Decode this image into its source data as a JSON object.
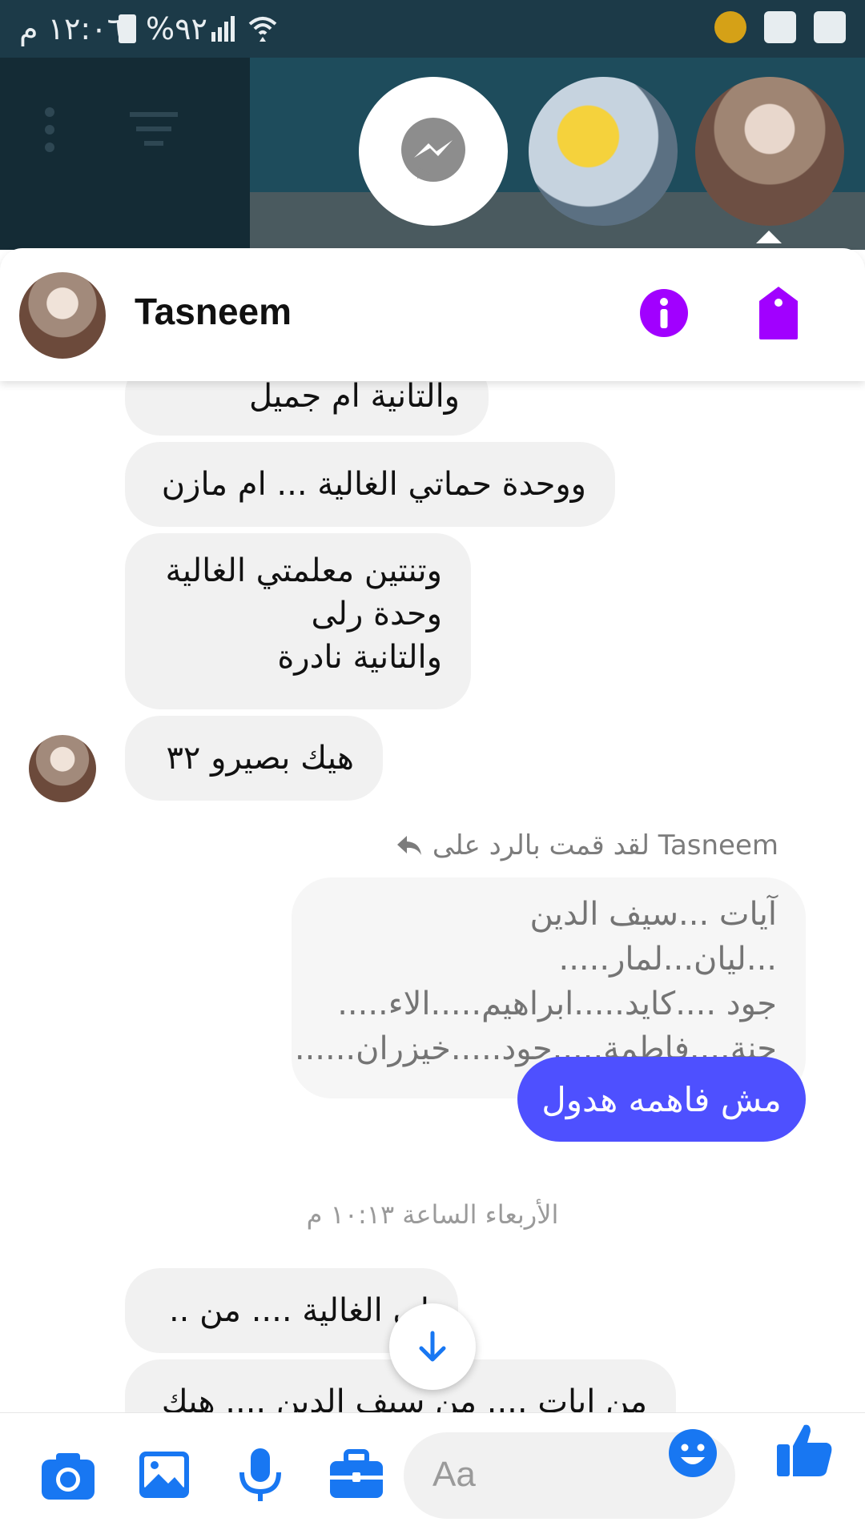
{
  "status_bar": {
    "time": "١٢:٠٦ م",
    "battery": "%٩٢"
  },
  "chat_heads": {
    "items": [
      "messenger-app",
      "contact-2",
      "contact-tasneem"
    ]
  },
  "header": {
    "name": "Tasneem"
  },
  "messages": {
    "incoming": [
      "والتانية ام جميل",
      "ووحدة حماتي الغالية ... ام مازن",
      "وتنتين معلمتي الغالية\nوحدة رلى\nوالتانية نادرة",
      "هيك بصيرو ٣٢"
    ],
    "reply_note": "Tasneem لقد قمت بالرد على",
    "quoted": "آيات ...سيف الدين ...ليان...لمار.....\nجود ....كايد.....ابراهيم.....الاء.....\nجنة....فاطمة.....جود.....خيزران......",
    "mine": "مش فاهمه هدول",
    "timestamp": "الأربعاء الساعة ١٠:١٣ م",
    "later": [
      "لي الغالية .... من ..",
      "من ايات .... من سيف الدين .... هيك"
    ]
  },
  "composer": {
    "placeholder": "Aa"
  },
  "colors": {
    "accent": "#4e50ff",
    "icon_blue": "#1877f2",
    "purple": "#a100ff",
    "status_bar": "#1c3a48"
  }
}
